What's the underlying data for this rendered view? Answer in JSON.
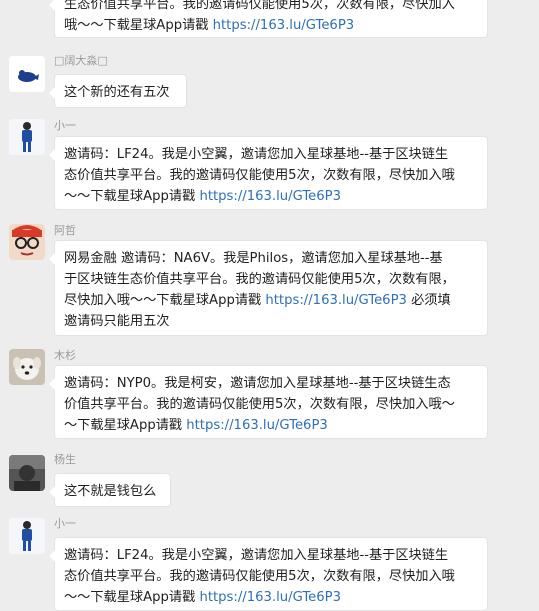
{
  "top_fragment": {
    "line1": "生态价值共享平台。我的邀请码仅能使用5次，次数有限，尽快加入",
    "line2_text": "哦～～下载星球App请戳 ",
    "line2_link": "https://163.lu/GTe6P3"
  },
  "messages": [
    {
      "sender": "□阔大淼□",
      "lines": [
        "这个新的还有五次"
      ]
    },
    {
      "sender": "小一",
      "line1": "邀请码：LF24。我是小空翼，邀请您加入星球基地--基于区块链生",
      "line2": "态价值共享平台。我的邀请码仅能使用5次，次数有限，尽快加入哦",
      "line3_text": "～～下载星球App请戳 ",
      "line3_link": "https://163.lu/GTe6P3"
    },
    {
      "sender": "阿哲",
      "line1": "网易金融 邀请码：NA6V。我是Philos，邀请您加入星球基地--基",
      "line2": "于区块链生态价值共享平台。我的邀请码仅能使用5次，次数有限，",
      "line3_text": "尽快加入哦～～下载星球App请戳 ",
      "line3_link": "https://163.lu/GTe6P3",
      "line3_tail": " 必须填",
      "line4": "邀请码只能用五次"
    },
    {
      "sender": "木杉",
      "line1": "邀请码：NYP0。我是柯安，邀请您加入星球基地--基于区块链生态",
      "line2": "价值共享平台。我的邀请码仅能使用5次，次数有限，尽快加入哦～",
      "line3_text": "～下载星球App请戳 ",
      "line3_link": "https://163.lu/GTe6P3"
    },
    {
      "sender": "杨生",
      "lines": [
        "这不就是钱包么"
      ]
    },
    {
      "sender": "小一",
      "line1": "邀请码：LF24。我是小空翼，邀请您加入星球基地--基于区块链生",
      "line2": "态价值共享平台。我的邀请码仅能使用5次，次数有限，尽快加入哦",
      "line3_text": "～～下载星球App请戳 ",
      "line3_link": "https://163.lu/GTe6P3"
    }
  ],
  "colors": {
    "background": "#ededed",
    "bubble": "#ffffff",
    "link": "#2f6fb8",
    "sender": "#9a9a9a"
  },
  "avatars": [
    "penguin-avatar",
    "player-avatar",
    "glasses-avatar",
    "dog-avatar",
    "dark-avatar",
    "player-avatar"
  ]
}
